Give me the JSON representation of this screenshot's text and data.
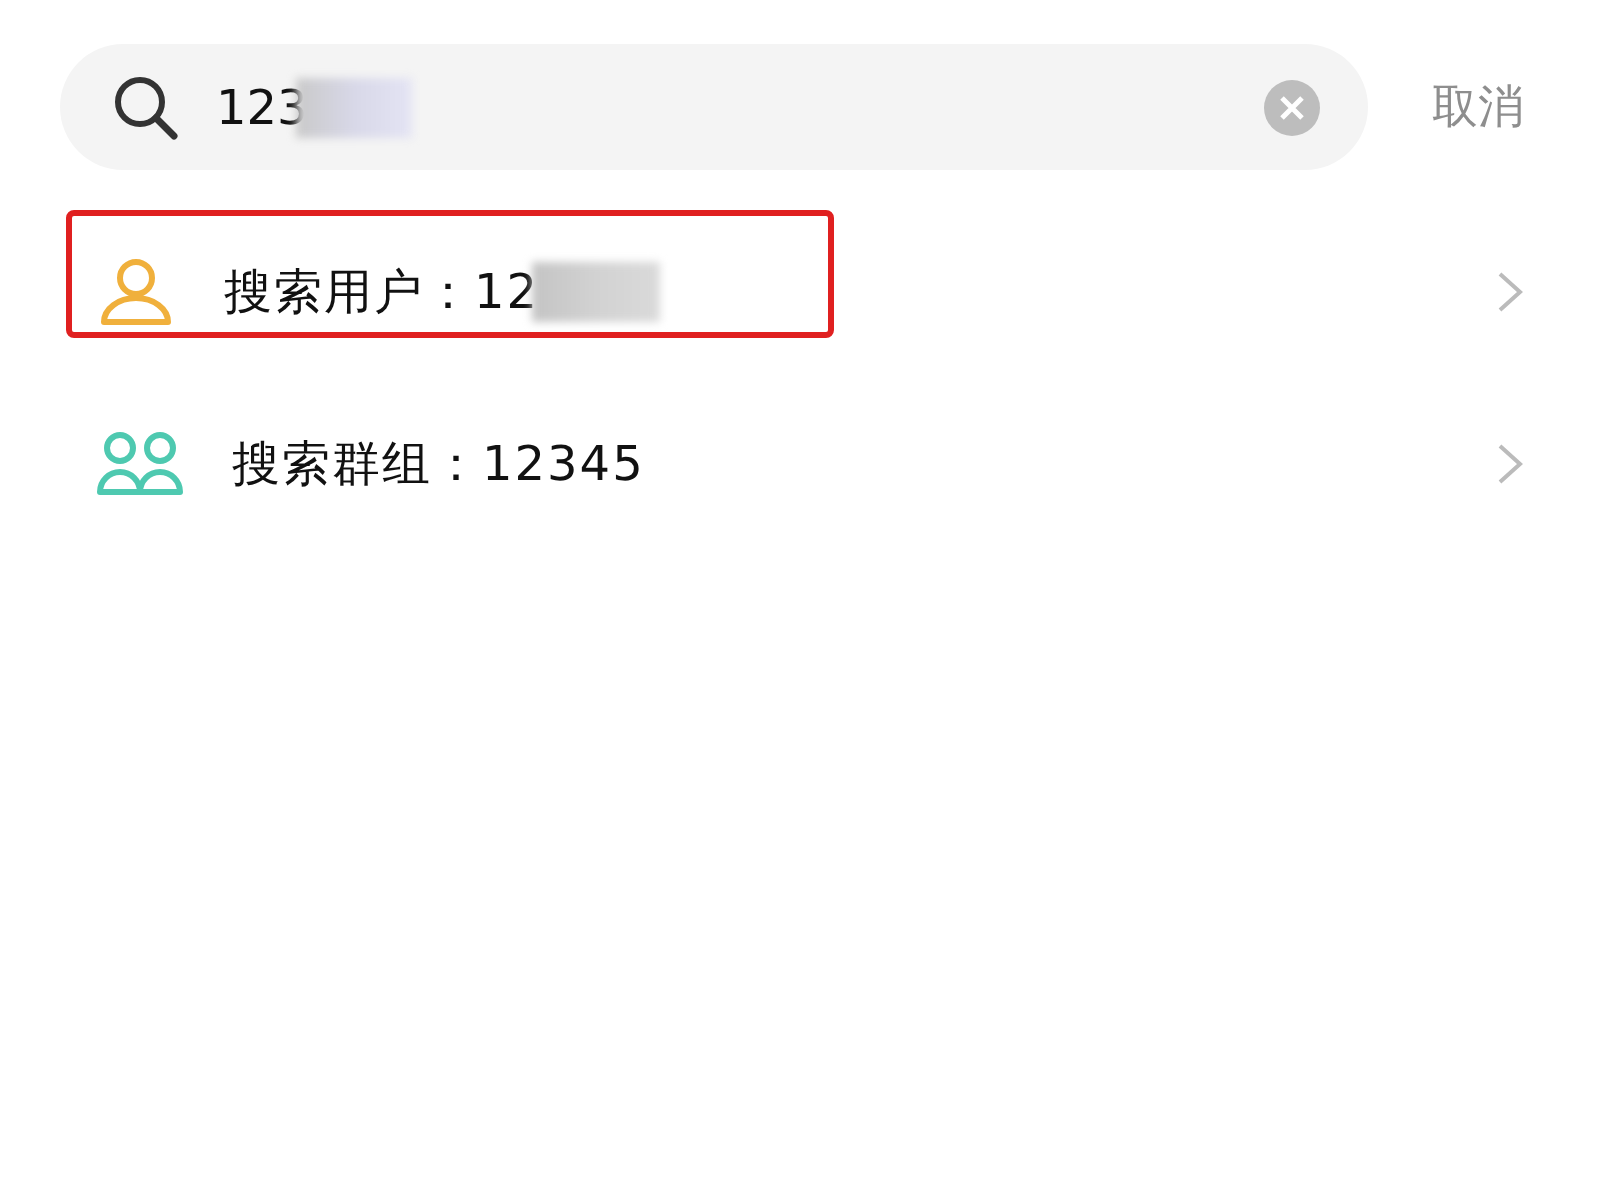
{
  "search": {
    "value": "123",
    "redacted": true,
    "cancel": "取消"
  },
  "results": [
    {
      "kind": "user",
      "label": "搜索用户：12",
      "redacted": true,
      "highlighted": true
    },
    {
      "kind": "group",
      "label": "搜索群组：12345",
      "redacted": false,
      "highlighted": false
    }
  ]
}
